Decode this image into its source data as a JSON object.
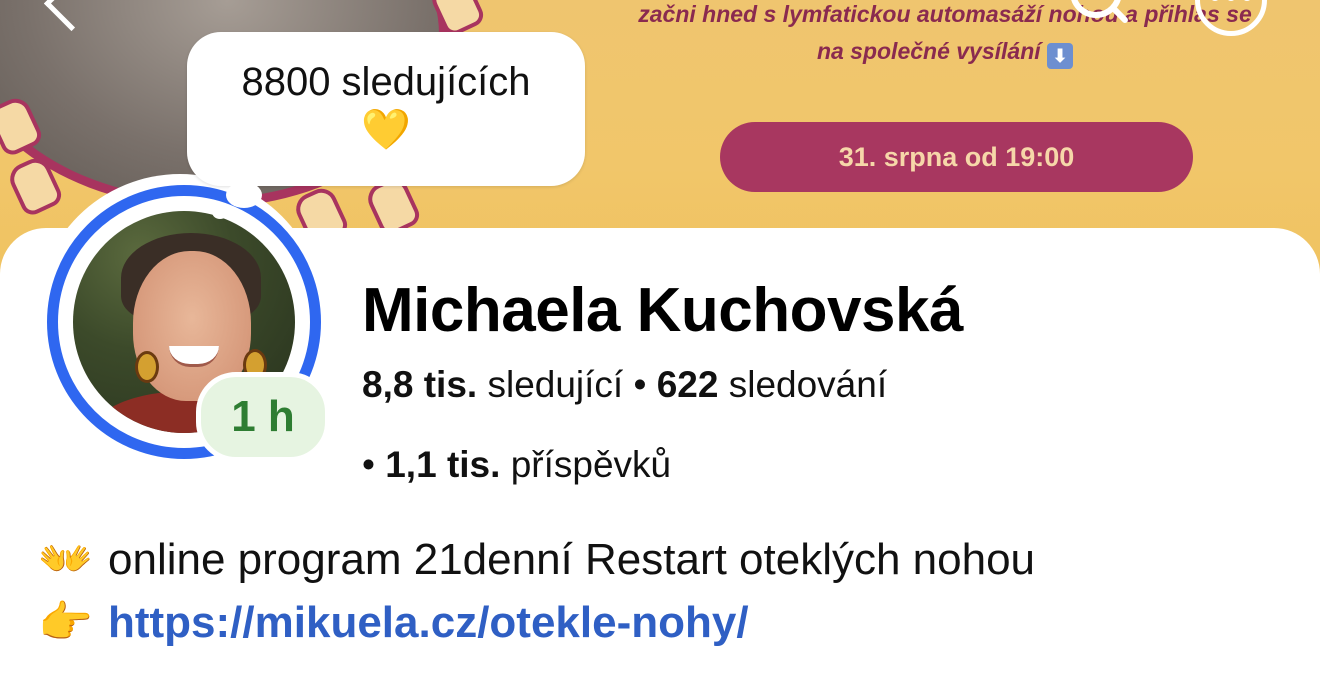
{
  "cover": {
    "text_line1": "začni hned s lymfatickou automasáží nohou a přihlas se",
    "text_line2": "na společné vysílání",
    "arrow_glyph": "⬇",
    "date_pill": "31. srpna od 19:00",
    "bg_color": "#efc56f",
    "accent_color": "#a83760"
  },
  "bubble": {
    "text": "8800 sledujících",
    "heart": "💛"
  },
  "avatar": {
    "time_badge": "1 h",
    "ring_color": "#2f67f0"
  },
  "profile": {
    "name": "Michaela Kuchovská",
    "followers_count": "8,8 tis.",
    "followers_label": " sledující • ",
    "following_count": "622",
    "following_label": " sledování",
    "posts_bullet": "• ",
    "posts_count": "1,1 tis.",
    "posts_label": " příspěvků"
  },
  "bio": {
    "line1_emoji": "👐",
    "line1_text": "online program 21denní Restart oteklých nohou",
    "line2_emoji": "👉",
    "link_text": "https://mikuela.cz/otekle-nohy/",
    "link_color": "#2f5fc4"
  },
  "icons": [
    "back-icon",
    "search-icon",
    "more-icon"
  ]
}
